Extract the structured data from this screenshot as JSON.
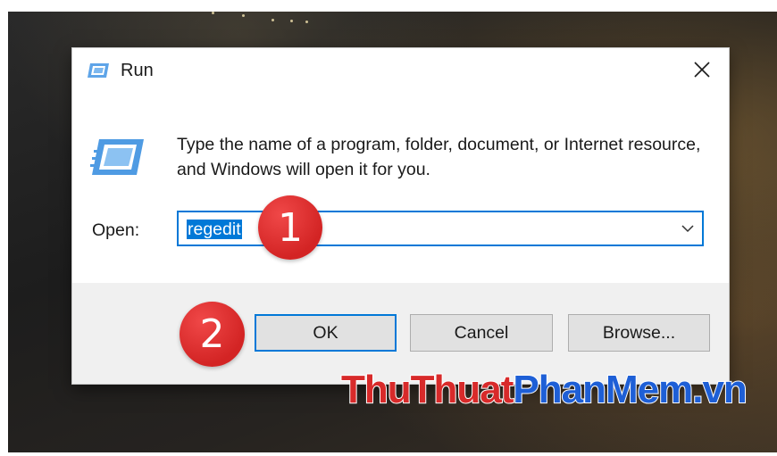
{
  "dialog": {
    "title": "Run",
    "title_icon": "run-icon",
    "close_icon": "close-icon",
    "description": "Type the name of a program, folder, document, or Internet resource, and Windows will open it for you.",
    "open_label": "Open:",
    "open_value": "regedit",
    "dropdown_icon": "chevron-down-icon",
    "buttons": {
      "ok": "OK",
      "cancel": "Cancel",
      "browse": "Browse..."
    }
  },
  "annotations": {
    "step1": "1",
    "step2": "2"
  },
  "watermark": {
    "part1": "Thu",
    "part2": "Thuat",
    "part3": "PhanMem",
    "part4": ".vn"
  },
  "colors": {
    "accent": "#0078d7",
    "step_badge": "#d32424",
    "watermark_red": "#d82a2a",
    "watermark_blue": "#1e5fd6"
  }
}
